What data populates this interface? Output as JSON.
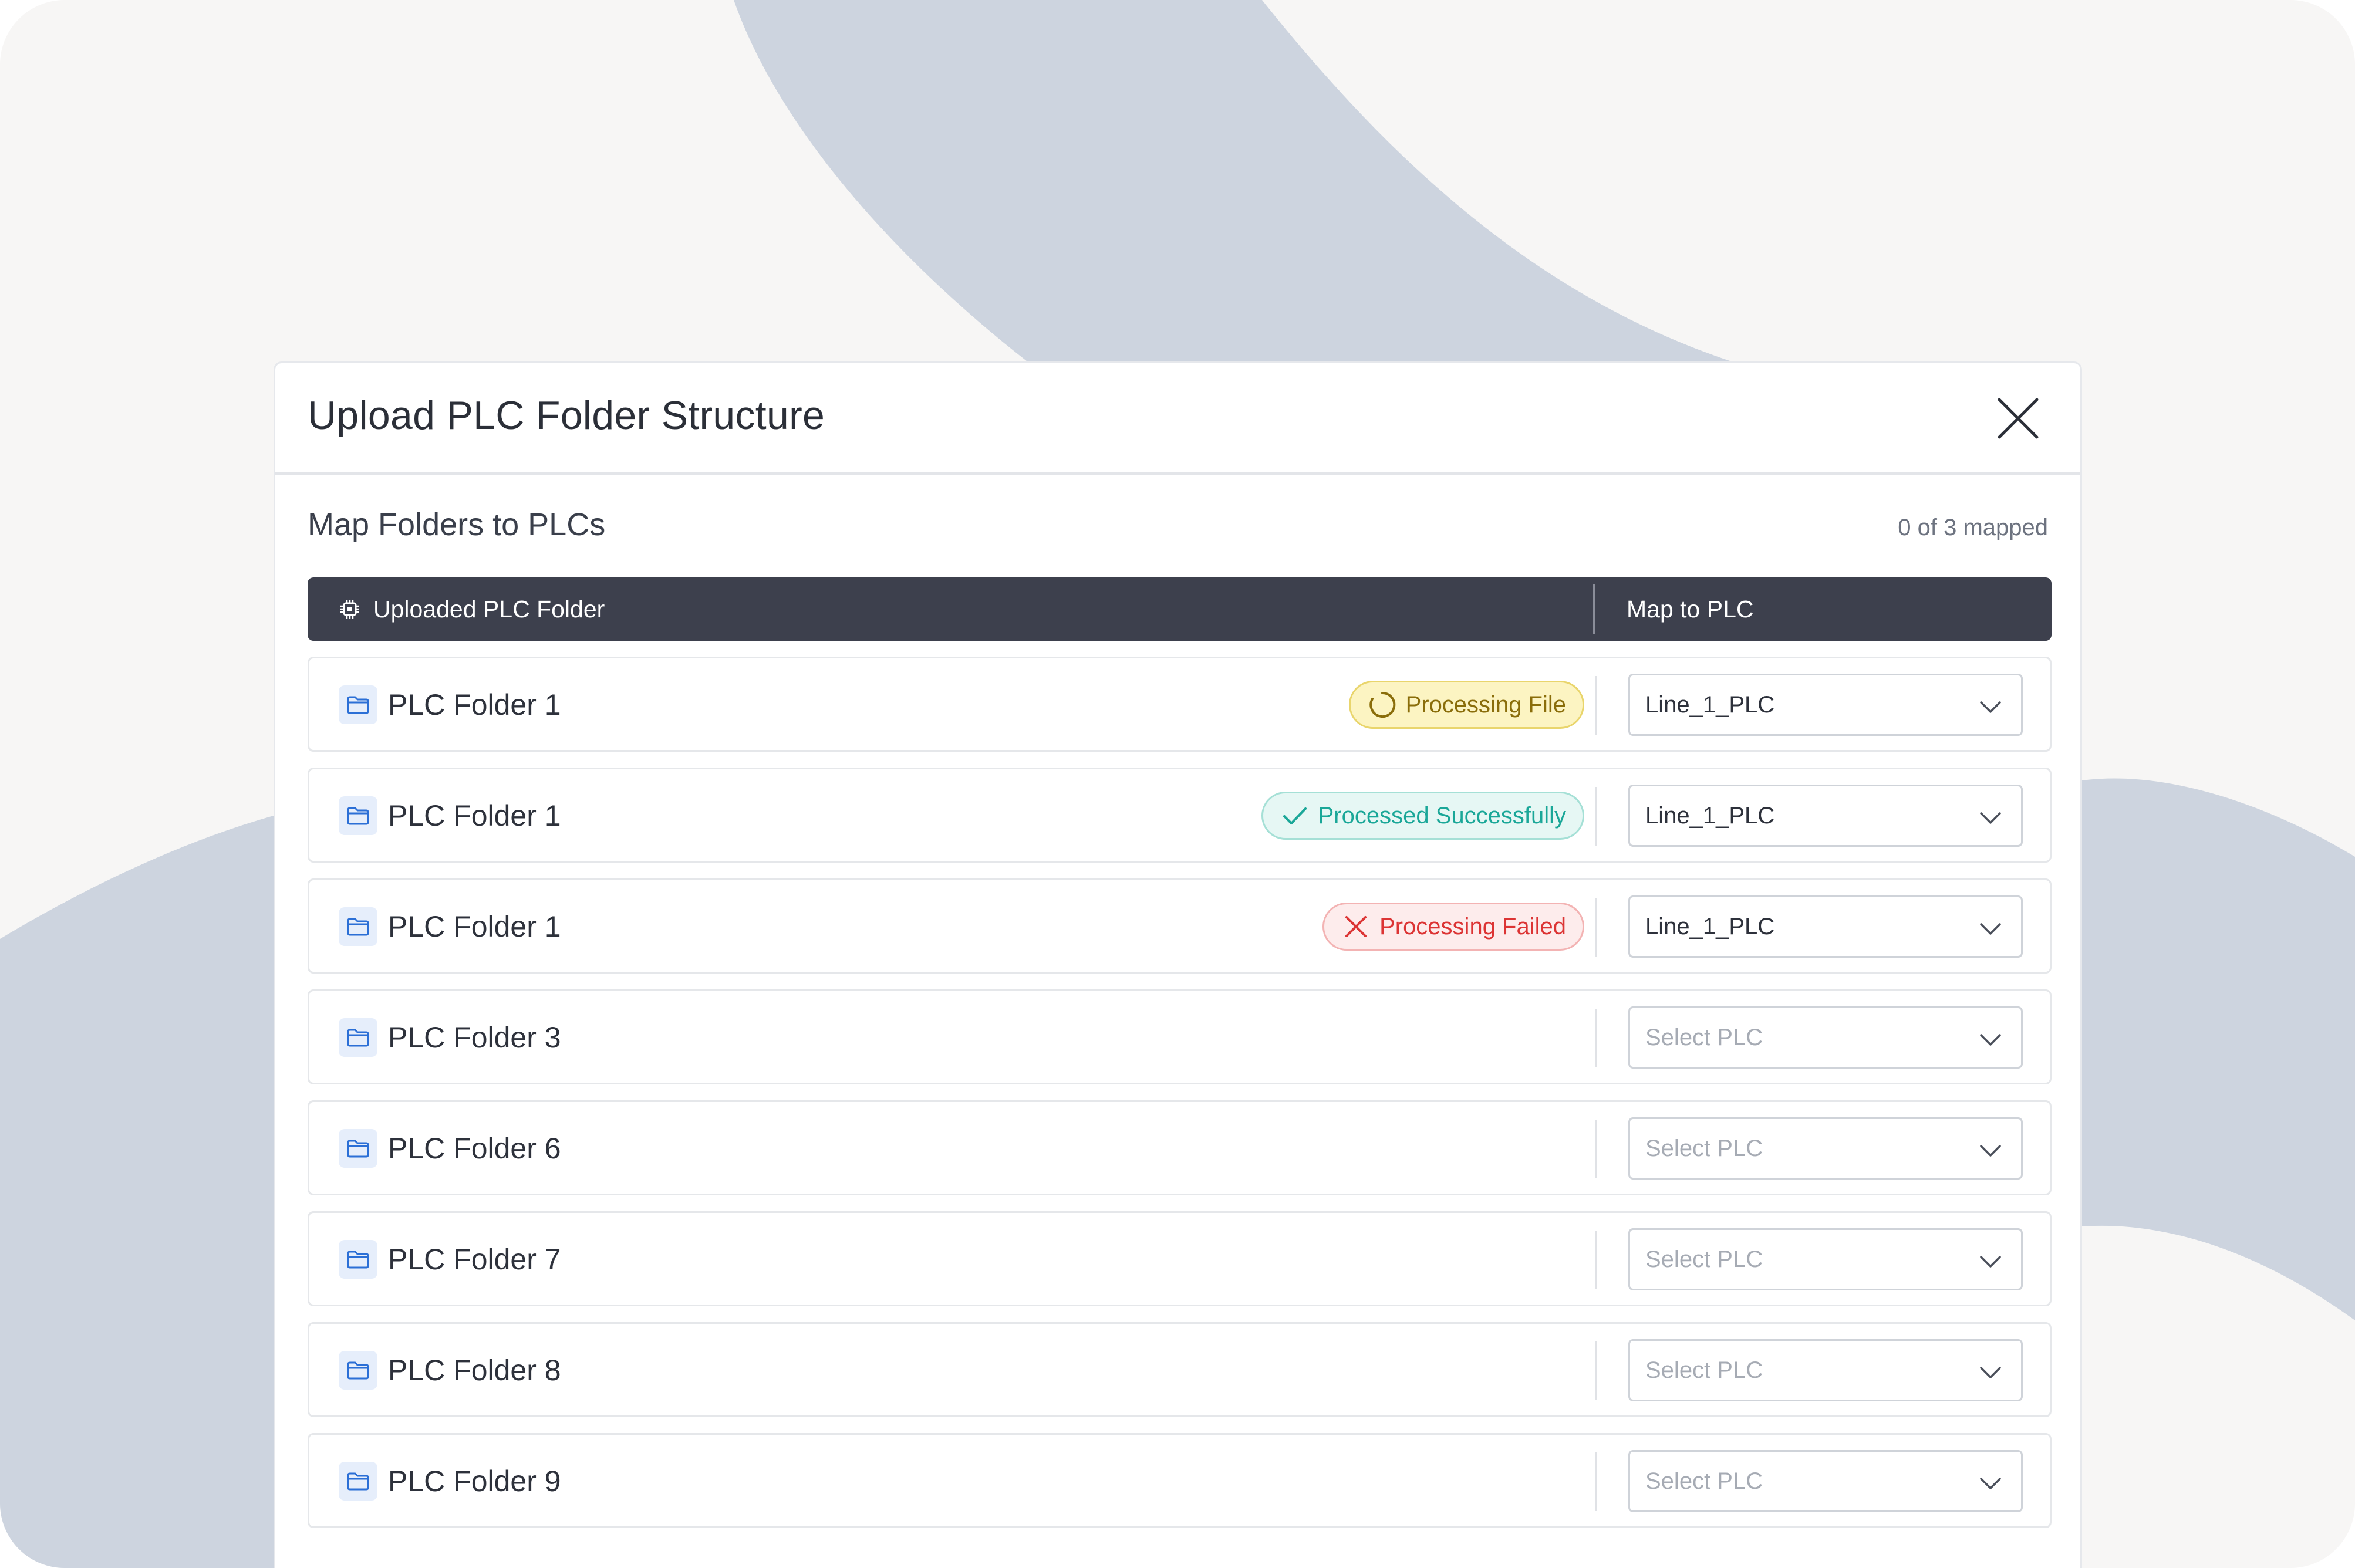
{
  "colors": {
    "header_bg": "#3d404d",
    "processing": "#8a6d0a",
    "success": "#1aa798",
    "failed": "#dc3434",
    "folder_icon": "#2b6fd6"
  },
  "modal": {
    "title": "Upload PLC Folder Structure",
    "close_icon": "close-icon"
  },
  "section": {
    "title": "Map Folders to PLCs",
    "mapped": "0 of 3 mapped"
  },
  "table": {
    "col_folder": "Uploaded PLC Folder",
    "col_folder_icon": "chip-icon",
    "col_map": "Map to PLC"
  },
  "rows": [
    {
      "name": "PLC Folder 1",
      "status": "Processing File",
      "status_type": "processing",
      "plc": "Line_1_PLC"
    },
    {
      "name": "PLC Folder 1",
      "status": "Processed Successfully",
      "status_type": "success",
      "plc": "Line_1_PLC"
    },
    {
      "name": "PLC Folder 1",
      "status": "Processing Failed",
      "status_type": "failed",
      "plc": "Line_1_PLC"
    },
    {
      "name": "PLC Folder 3",
      "status": "",
      "status_type": "none",
      "plc": "Select PLC"
    },
    {
      "name": "PLC Folder 6",
      "status": "",
      "status_type": "none",
      "plc": "Select PLC"
    },
    {
      "name": "PLC Folder 7",
      "status": "",
      "status_type": "none",
      "plc": "Select PLC"
    },
    {
      "name": "PLC Folder 8",
      "status": "",
      "status_type": "none",
      "plc": "Select PLC"
    },
    {
      "name": "PLC Folder 9",
      "status": "",
      "status_type": "none",
      "plc": "Select PLC"
    }
  ]
}
